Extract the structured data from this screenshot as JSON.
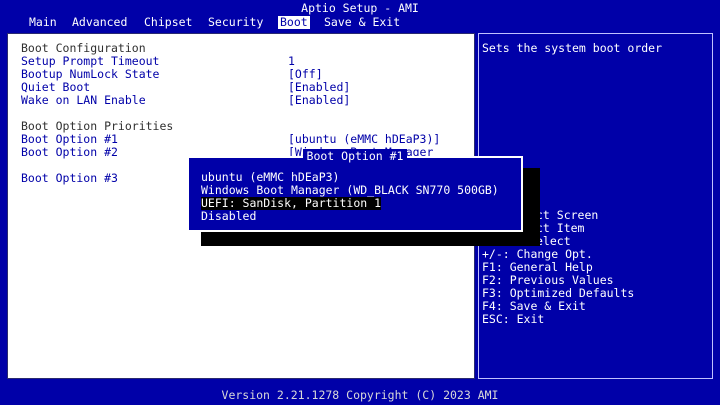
{
  "window": {
    "title": "Aptio Setup - AMI"
  },
  "menu": {
    "tabs": [
      {
        "label": "Main"
      },
      {
        "label": "Advanced"
      },
      {
        "label": "Chipset"
      },
      {
        "label": "Security"
      },
      {
        "label": "Boot",
        "active": true
      },
      {
        "label": "Save & Exit"
      }
    ]
  },
  "main": {
    "section_boot_config": "Boot Configuration",
    "items": [
      {
        "label": "Setup Prompt Timeout",
        "value": "1"
      },
      {
        "label": "Bootup NumLock State",
        "value": "[Off]"
      },
      {
        "label": "Quiet Boot",
        "value": "[Enabled]"
      },
      {
        "label": "Wake on LAN Enable",
        "value": "[Enabled]"
      }
    ],
    "section_priorities": "Boot Option Priorities",
    "boot_options": [
      {
        "label": "Boot Option #1",
        "value": "[ubuntu (eMMC hDEaP3)]"
      },
      {
        "label": "Boot Option #2",
        "value": "[Windows Boot Manager"
      },
      {
        "label": "Boot Option #3",
        "value": ""
      }
    ]
  },
  "help": {
    "description": "Sets the system boot order",
    "keys": [
      "ct Screen",
      "ct Item",
      "elect",
      "+/-: Change Opt.",
      "F1: General Help",
      "F2: Previous Values",
      "F3: Optimized Defaults",
      "F4: Save & Exit",
      "ESC: Exit"
    ]
  },
  "popup": {
    "title": "Boot Option #1",
    "options": [
      "ubuntu (eMMC hDEaP3)",
      "Windows Boot Manager (WD_BLACK SN770 500GB)",
      "UEFI: SanDisk, Partition 1",
      "Disabled"
    ],
    "selected_index": 2
  },
  "footer": {
    "text": "Version 2.21.1278 Copyright (C) 2023 AMI"
  },
  "colors": {
    "background": "#0000a8",
    "panel": "#ffffff",
    "text_blue": "#0000a8",
    "highlight": "#000000"
  }
}
